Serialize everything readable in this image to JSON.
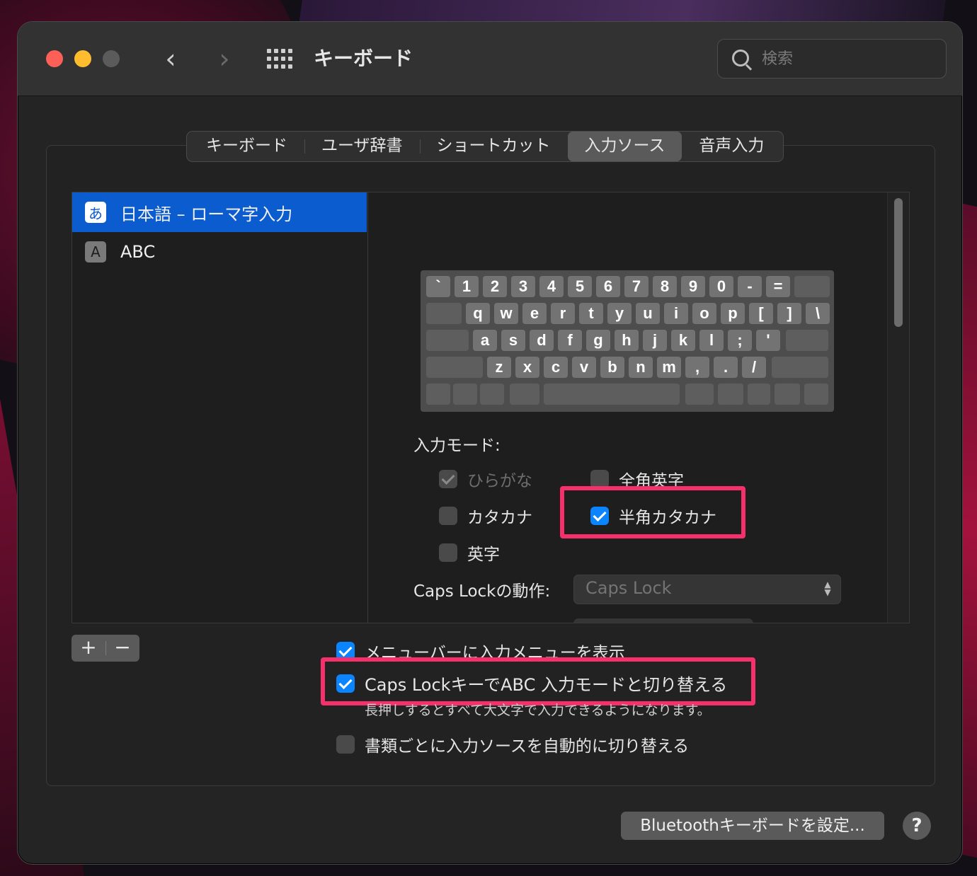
{
  "window": {
    "title": "キーボード"
  },
  "search": {
    "placeholder": "検索"
  },
  "tabs": [
    "キーボード",
    "ユーザ辞書",
    "ショートカット",
    "入力ソース",
    "音声入力"
  ],
  "active_tab": "入力ソース",
  "sources": [
    {
      "icon": "あ",
      "label": "日本語 – ローマ字入力",
      "selected": true
    },
    {
      "icon": "A",
      "label": "ABC",
      "selected": false
    }
  ],
  "keyboard": {
    "row1": [
      "`",
      "1",
      "2",
      "3",
      "4",
      "5",
      "6",
      "7",
      "8",
      "9",
      "0",
      "-",
      "="
    ],
    "row2": [
      "q",
      "w",
      "e",
      "r",
      "t",
      "y",
      "u",
      "i",
      "o",
      "p",
      "[",
      "]",
      "\\"
    ],
    "row3": [
      "a",
      "s",
      "d",
      "f",
      "g",
      "h",
      "j",
      "k",
      "l",
      ";",
      "'"
    ],
    "row4": [
      "z",
      "x",
      "c",
      "v",
      "b",
      "n",
      "m",
      ",",
      ".",
      "/"
    ]
  },
  "input_mode": {
    "label": "入力モード:",
    "hiragana": "ひらがな",
    "zenkaku_eiji": "全角英字",
    "katakana": "カタカナ",
    "hankaku_katakana": "半角カタカナ",
    "eiji": "英字"
  },
  "caps_lock": {
    "label": "Caps Lockの動作:",
    "value": "Caps Lock"
  },
  "list_buttons": {
    "add": "+",
    "remove": "−"
  },
  "options": {
    "show_menu": "メニューバーに入力メニューを表示",
    "caps_switch": "Caps LockキーでABC 入力モードと切り替える",
    "caps_note": "長押しするとすべて大文字で入力できるようになります。",
    "auto_switch": "書類ごとに入力ソースを自動的に切り替える"
  },
  "buttons": {
    "bluetooth": "Bluetoothキーボードを設定...",
    "help": "?"
  },
  "colors": {
    "accent": "#0a84ff",
    "selection": "#0b5ccf",
    "highlight": "#f5306a"
  }
}
